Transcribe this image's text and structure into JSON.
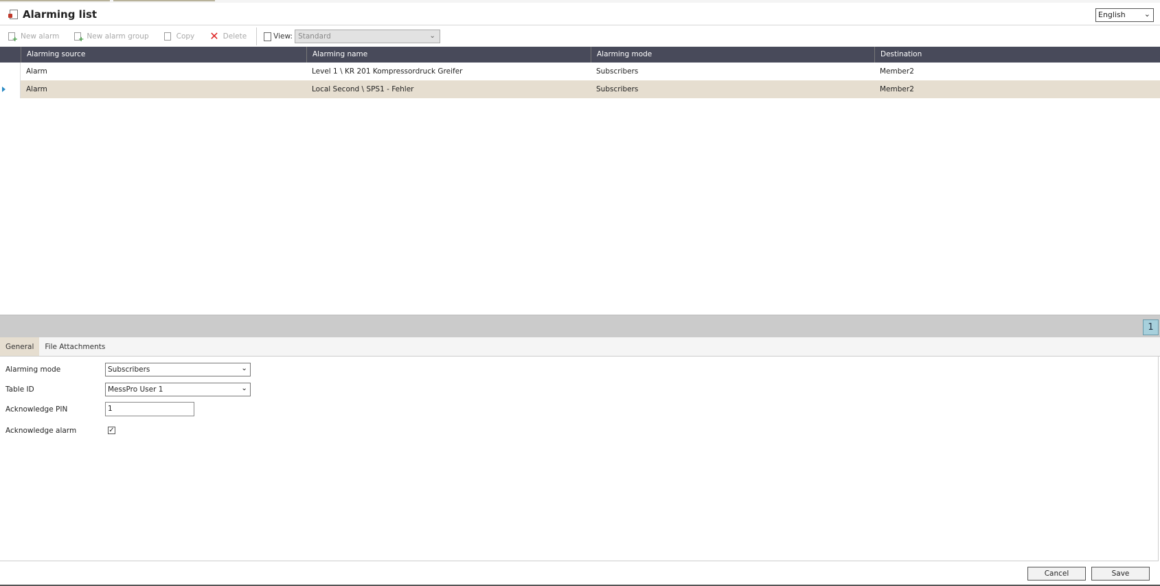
{
  "header": {
    "title": "Alarming list",
    "language": "English"
  },
  "toolbar": {
    "new_alarm": "New alarm",
    "new_alarm_group": "New alarm group",
    "copy": "Copy",
    "delete": "Delete",
    "view_label": "View:",
    "view_value": "Standard"
  },
  "table": {
    "columns": [
      "Alarming source",
      "Alarming name",
      "Alarming mode",
      "Destination"
    ],
    "rows": [
      {
        "source": "Alarm",
        "name": "Level 1 \\ KR 201 Kompressordruck Greifer",
        "mode": "Subscribers",
        "destination": "Member2",
        "selected": false
      },
      {
        "source": "Alarm",
        "name": "Local Second \\ SPS1 - Fehler",
        "mode": "Subscribers",
        "destination": "Member2",
        "selected": true
      }
    ]
  },
  "pager": {
    "current_page": "1"
  },
  "detail": {
    "tabs": [
      "General",
      "File Attachments"
    ],
    "active_tab": "General",
    "alarming_mode_label": "Alarming mode",
    "alarming_mode_value": "Subscribers",
    "table_id_label": "Table ID",
    "table_id_value": "MessPro User 1",
    "ack_pin_label": "Acknowledge PIN",
    "ack_pin_value": "1",
    "ack_alarm_label": "Acknowledge alarm",
    "ack_alarm_checked": true
  },
  "footer": {
    "cancel": "Cancel",
    "save": "Save"
  },
  "colors": {
    "header_bg": "#484a5a",
    "selected_row": "#e6ded0",
    "pager_bg": "#cbcbcb",
    "page_button": "#a7d0dc"
  }
}
